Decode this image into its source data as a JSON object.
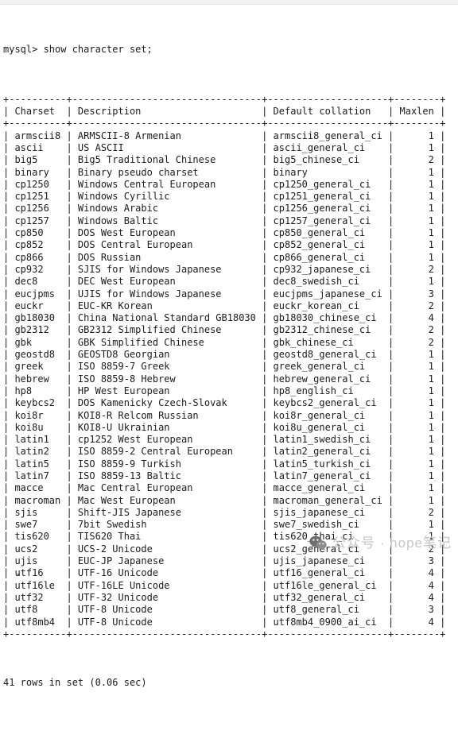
{
  "terminal": {
    "prompt": "mysql>",
    "command": "show character set;",
    "prompt_line": "mysql> show character set;",
    "footer": "41 rows in set (0.06 sec)",
    "columns": [
      {
        "header": "Charset",
        "width": 8,
        "align": "left"
      },
      {
        "header": "Description",
        "width": 31,
        "align": "left"
      },
      {
        "header": "Default collation",
        "width": 19,
        "align": "left"
      },
      {
        "header": "Maxlen",
        "width": 6,
        "align": "right"
      }
    ],
    "rows": [
      [
        "armscii8",
        "ARMSCII-8 Armenian",
        "armscii8_general_ci",
        "1"
      ],
      [
        "ascii",
        "US ASCII",
        "ascii_general_ci",
        "1"
      ],
      [
        "big5",
        "Big5 Traditional Chinese",
        "big5_chinese_ci",
        "2"
      ],
      [
        "binary",
        "Binary pseudo charset",
        "binary",
        "1"
      ],
      [
        "cp1250",
        "Windows Central European",
        "cp1250_general_ci",
        "1"
      ],
      [
        "cp1251",
        "Windows Cyrillic",
        "cp1251_general_ci",
        "1"
      ],
      [
        "cp1256",
        "Windows Arabic",
        "cp1256_general_ci",
        "1"
      ],
      [
        "cp1257",
        "Windows Baltic",
        "cp1257_general_ci",
        "1"
      ],
      [
        "cp850",
        "DOS West European",
        "cp850_general_ci",
        "1"
      ],
      [
        "cp852",
        "DOS Central European",
        "cp852_general_ci",
        "1"
      ],
      [
        "cp866",
        "DOS Russian",
        "cp866_general_ci",
        "1"
      ],
      [
        "cp932",
        "SJIS for Windows Japanese",
        "cp932_japanese_ci",
        "2"
      ],
      [
        "dec8",
        "DEC West European",
        "dec8_swedish_ci",
        "1"
      ],
      [
        "eucjpms",
        "UJIS for Windows Japanese",
        "eucjpms_japanese_ci",
        "3"
      ],
      [
        "euckr",
        "EUC-KR Korean",
        "euckr_korean_ci",
        "2"
      ],
      [
        "gb18030",
        "China National Standard GB18030",
        "gb18030_chinese_ci",
        "4"
      ],
      [
        "gb2312",
        "GB2312 Simplified Chinese",
        "gb2312_chinese_ci",
        "2"
      ],
      [
        "gbk",
        "GBK Simplified Chinese",
        "gbk_chinese_ci",
        "2"
      ],
      [
        "geostd8",
        "GEOSTD8 Georgian",
        "geostd8_general_ci",
        "1"
      ],
      [
        "greek",
        "ISO 8859-7 Greek",
        "greek_general_ci",
        "1"
      ],
      [
        "hebrew",
        "ISO 8859-8 Hebrew",
        "hebrew_general_ci",
        "1"
      ],
      [
        "hp8",
        "HP West European",
        "hp8_english_ci",
        "1"
      ],
      [
        "keybcs2",
        "DOS Kamenicky Czech-Slovak",
        "keybcs2_general_ci",
        "1"
      ],
      [
        "koi8r",
        "KOI8-R Relcom Russian",
        "koi8r_general_ci",
        "1"
      ],
      [
        "koi8u",
        "KOI8-U Ukrainian",
        "koi8u_general_ci",
        "1"
      ],
      [
        "latin1",
        "cp1252 West European",
        "latin1_swedish_ci",
        "1"
      ],
      [
        "latin2",
        "ISO 8859-2 Central European",
        "latin2_general_ci",
        "1"
      ],
      [
        "latin5",
        "ISO 8859-9 Turkish",
        "latin5_turkish_ci",
        "1"
      ],
      [
        "latin7",
        "ISO 8859-13 Baltic",
        "latin7_general_ci",
        "1"
      ],
      [
        "macce",
        "Mac Central European",
        "macce_general_ci",
        "1"
      ],
      [
        "macroman",
        "Mac West European",
        "macroman_general_ci",
        "1"
      ],
      [
        "sjis",
        "Shift-JIS Japanese",
        "sjis_japanese_ci",
        "2"
      ],
      [
        "swe7",
        "7bit Swedish",
        "swe7_swedish_ci",
        "1"
      ],
      [
        "tis620",
        "TIS620 Thai",
        "tis620_thai_ci",
        "1"
      ],
      [
        "ucs2",
        "UCS-2 Unicode",
        "ucs2_general_ci",
        "2"
      ],
      [
        "ujis",
        "EUC-JP Japanese",
        "ujis_japanese_ci",
        "3"
      ],
      [
        "utf16",
        "UTF-16 Unicode",
        "utf16_general_ci",
        "4"
      ],
      [
        "utf16le",
        "UTF-16LE Unicode",
        "utf16le_general_ci",
        "4"
      ],
      [
        "utf32",
        "UTF-32 Unicode",
        "utf32_general_ci",
        "4"
      ],
      [
        "utf8",
        "UTF-8 Unicode",
        "utf8_general_ci",
        "3"
      ],
      [
        "utf8mb4",
        "UTF-8 Unicode",
        "utf8mb4_0900_ai_ci",
        "4"
      ]
    ]
  },
  "watermark": {
    "icon": "wechat-icon",
    "text": "公众号 · hope笔记"
  },
  "colors": {
    "background": "#ffffff",
    "text": "#1b1b1b",
    "watermark_text": "#c6c6c6",
    "watermark_icon": "#707070",
    "top_band": "#f2f2f2"
  }
}
